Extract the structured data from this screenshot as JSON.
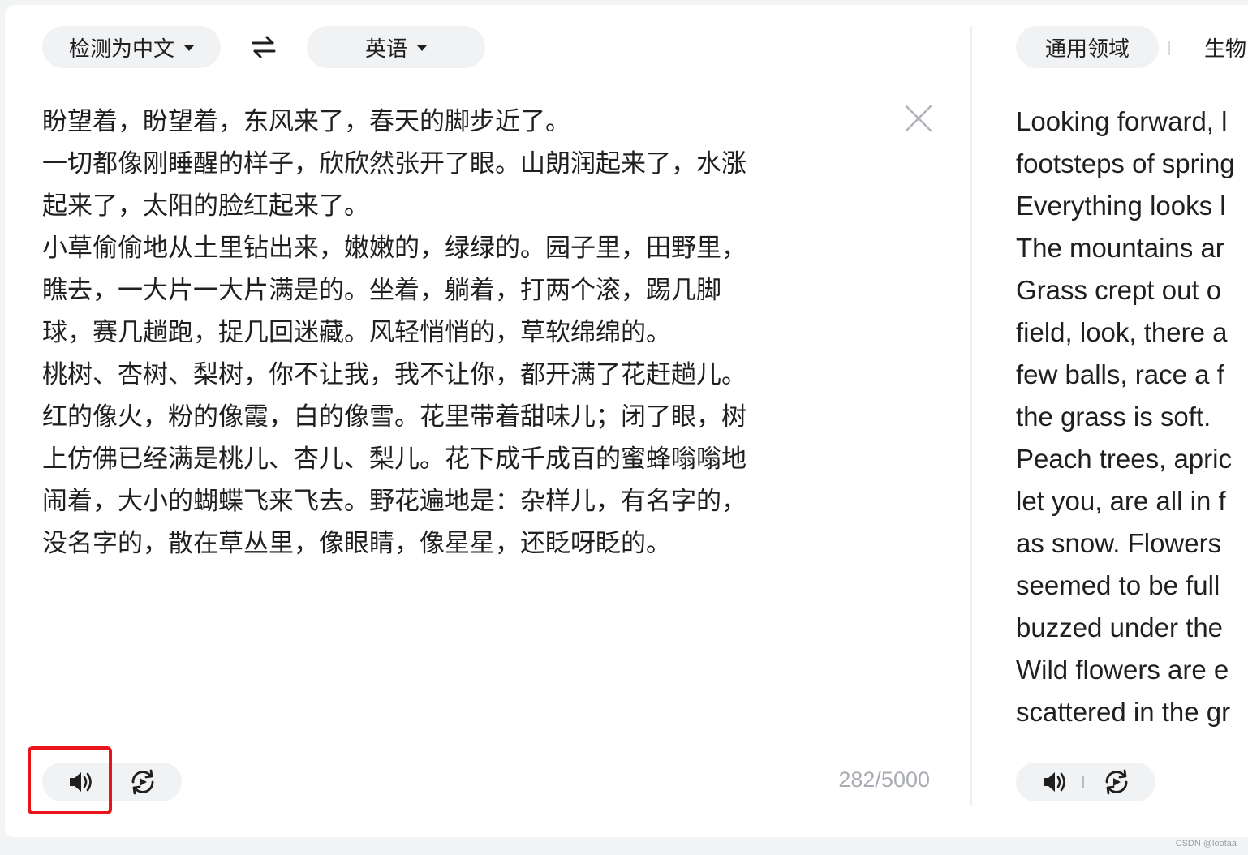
{
  "source": {
    "lang_label": "检测为中文",
    "target_lang_label": "英语",
    "lines": [
      "盼望着，盼望着，东风来了，春天的脚步近了。",
      "一切都像刚睡醒的样子，欣欣然张开了眼。山朗润起来了，水涨",
      "起来了，太阳的脸红起来了。",
      "小草偷偷地从土里钻出来，嫩嫩的，绿绿的。园子里，田野里，",
      "瞧去，一大片一大片满是的。坐着，躺着，打两个滚，踢几脚",
      "球，赛几趟跑，捉几回迷藏。风轻悄悄的，草软绵绵的。",
      "桃树、杏树、梨树，你不让我，我不让你，都开满了花赶趟儿。",
      "红的像火，粉的像霞，白的像雪。花里带着甜味儿；闭了眼，树",
      "上仿佛已经满是桃儿、杏儿、梨儿。花下成千成百的蜜蜂嗡嗡地",
      "闹着，大小的蝴蝶飞来飞去。野花遍地是：杂样儿，有名字的，",
      "没名字的，散在草丛里，像眼睛，像星星，还眨呀眨的。"
    ],
    "char_count": "282/5000"
  },
  "target": {
    "domain_general": "通用领域",
    "domain_bio": "生物",
    "lines": [
      "Looking forward, l",
      "footsteps of spring",
      "Everything looks l",
      "The mountains ar",
      "Grass crept out o",
      "field, look, there a",
      "few balls, race a f",
      "the grass is soft.",
      "Peach trees, apric",
      "let you, are all in f",
      "as snow. Flowers",
      "seemed to be full",
      "buzzed under the",
      "Wild flowers are e",
      "scattered in the gr"
    ]
  },
  "watermark": "CSDN @lootaa"
}
